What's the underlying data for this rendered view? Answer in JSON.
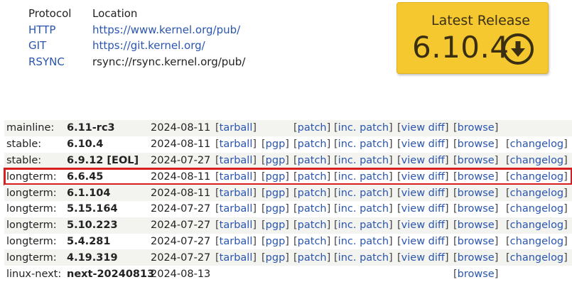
{
  "protocols": {
    "header": {
      "protocol": "Protocol",
      "location": "Location"
    },
    "rows": [
      {
        "name": "HTTP",
        "location": "https://www.kernel.org/pub/",
        "link": true
      },
      {
        "name": "GIT",
        "location": "https://git.kernel.org/",
        "link": true
      },
      {
        "name": "RSYNC",
        "location": "rsync://rsync.kernel.org/pub/",
        "link": false
      }
    ]
  },
  "latest_release": {
    "label": "Latest Release",
    "version": "6.10.4",
    "icon": "download-arrow-icon"
  },
  "releases": [
    {
      "category": "mainline:",
      "version": "6.11-rc3",
      "date": "2024-08-11",
      "links": [
        "tarball",
        "",
        "patch",
        "inc. patch",
        "view diff",
        "browse",
        ""
      ]
    },
    {
      "category": "stable:",
      "version": "6.10.4",
      "date": "2024-08-11",
      "links": [
        "tarball",
        "pgp",
        "patch",
        "inc. patch",
        "view diff",
        "browse",
        "changelog"
      ]
    },
    {
      "category": "stable:",
      "version": "6.9.12 [EOL]",
      "date": "2024-07-27",
      "links": [
        "tarball",
        "pgp",
        "patch",
        "inc. patch",
        "view diff",
        "browse",
        "changelog"
      ]
    },
    {
      "category": "longterm:",
      "version": "6.6.45",
      "date": "2024-08-11",
      "links": [
        "tarball",
        "pgp",
        "patch",
        "inc. patch",
        "view diff",
        "browse",
        "changelog"
      ],
      "highlighted": true
    },
    {
      "category": "longterm:",
      "version": "6.1.104",
      "date": "2024-08-11",
      "links": [
        "tarball",
        "pgp",
        "patch",
        "inc. patch",
        "view diff",
        "browse",
        "changelog"
      ]
    },
    {
      "category": "longterm:",
      "version": "5.15.164",
      "date": "2024-07-27",
      "links": [
        "tarball",
        "pgp",
        "patch",
        "inc. patch",
        "view diff",
        "browse",
        "changelog"
      ]
    },
    {
      "category": "longterm:",
      "version": "5.10.223",
      "date": "2024-07-27",
      "links": [
        "tarball",
        "pgp",
        "patch",
        "inc. patch",
        "view diff",
        "browse",
        "changelog"
      ]
    },
    {
      "category": "longterm:",
      "version": "5.4.281",
      "date": "2024-07-27",
      "links": [
        "tarball",
        "pgp",
        "patch",
        "inc. patch",
        "view diff",
        "browse",
        "changelog"
      ]
    },
    {
      "category": "longterm:",
      "version": "4.19.319",
      "date": "2024-07-27",
      "links": [
        "tarball",
        "pgp",
        "patch",
        "inc. patch",
        "view diff",
        "browse",
        "changelog"
      ]
    },
    {
      "category": "linux-next:",
      "version": "next-20240813",
      "date": "2024-08-13",
      "links": [
        "",
        "",
        "",
        "",
        "",
        "browse",
        ""
      ]
    }
  ],
  "colors": {
    "link": "#2a55b0",
    "highlight_border": "#d81f1f",
    "release_box": "#f4c82e"
  }
}
